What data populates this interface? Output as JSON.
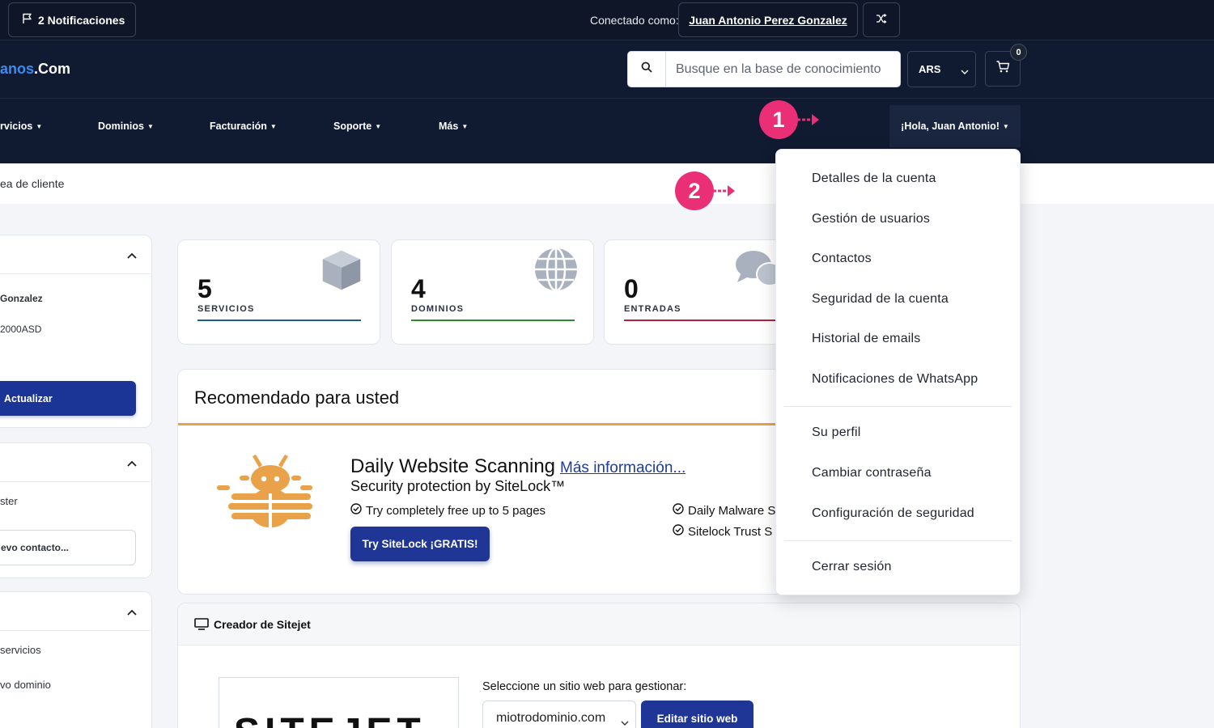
{
  "topbar": {
    "notifications_label": "2  Notificaciones",
    "connected_label": "Conectado como:",
    "user_name": "Juan Antonio Perez Gonzalez"
  },
  "header": {
    "logo_part1": "anos",
    "logo_part2": ".Com",
    "search_placeholder": "Busque en la base de conocimiento",
    "currency": "ARS",
    "cart_count": "0"
  },
  "nav": {
    "items": [
      "rvicios",
      "Dominios",
      "Facturación",
      "Soporte",
      "Más"
    ],
    "user_greeting": "¡Hola, Juan Antonio!"
  },
  "breadcrumb": "ea de cliente",
  "sidebar": {
    "name_fragment": "Gonzalez",
    "code_fragment": "2000ASD",
    "update_button": "Actualizar",
    "contact_item": "ster",
    "new_contact_button": "evo contacto...",
    "services_link": "servicios",
    "new_domain_link": "vo dominio"
  },
  "stats": [
    {
      "value": "5",
      "label": "SERVICIOS",
      "color": "#1b5e8a"
    },
    {
      "value": "4",
      "label": "DOMINIOS",
      "color": "#2e8b2e"
    },
    {
      "value": "0",
      "label": "ENTRADAS",
      "color": "#b3223a"
    }
  ],
  "recommended": {
    "title": "Recomendado para usted",
    "product_title": "Daily Website Scanning",
    "more_info_link": "Más información...",
    "subtitle": "Security protection by SiteLock™",
    "feature_1": "Try completely free up to 5 pages",
    "feature_2": "Daily Malware S",
    "feature_3": "Sitelock Trust S",
    "cta_button": "Try SiteLock ¡GRATIS!"
  },
  "sitejet": {
    "title": "Creador de Sitejet",
    "logo_text": "SITEJET",
    "select_label": "Seleccione un sitio web para gestionar:",
    "selected_site": "miotrodominio.com",
    "edit_button": "Editar sitio web"
  },
  "dropdown": {
    "group1": [
      "Detalles de la cuenta",
      "Gestión de usuarios",
      "Contactos",
      "Seguridad de la cuenta",
      "Historial de emails",
      "Notificaciones de WhatsApp"
    ],
    "group2": [
      "Su perfil",
      "Cambiar contraseña",
      "Configuración de seguridad"
    ],
    "logout": "Cerrar sesión"
  },
  "markers": {
    "step1": "1",
    "step2": "2",
    "color": "#ea2f76"
  }
}
